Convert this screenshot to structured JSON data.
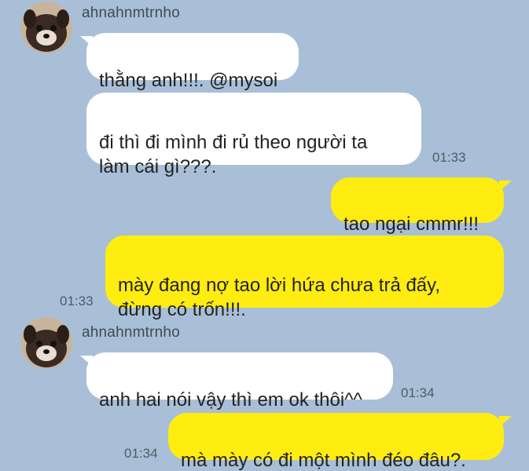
{
  "theme": {
    "background": "#a9bfd7",
    "incoming_bubble": "#ffffff",
    "outgoing_bubble": "#ffec10"
  },
  "messages": [
    {
      "type": "sender",
      "name": "ahnahnmtrnho",
      "avatar": "dog-avatar"
    },
    {
      "type": "incoming",
      "text": "thằng anh!!!. @mysoi"
    },
    {
      "type": "incoming",
      "text": "đi thì đi mình đi rủ theo người ta\nlàm cái gì???.",
      "time": "01:33"
    },
    {
      "type": "outgoing",
      "text": "tao ngại cmmr!!!"
    },
    {
      "type": "outgoing",
      "text": "mày đang nợ tao lời hứa chưa trả đấy,\nđừng có trốn!!!.",
      "time": "01:33"
    },
    {
      "type": "sender",
      "name": "ahnahnmtrnho",
      "avatar": "dog-avatar"
    },
    {
      "type": "incoming",
      "text": "anh hai nói vậy thì em ok thôi^^",
      "time": "01:34"
    },
    {
      "type": "outgoing",
      "text": "mà mày có đi một mình đéo đâu?.",
      "time": "01:34"
    }
  ]
}
